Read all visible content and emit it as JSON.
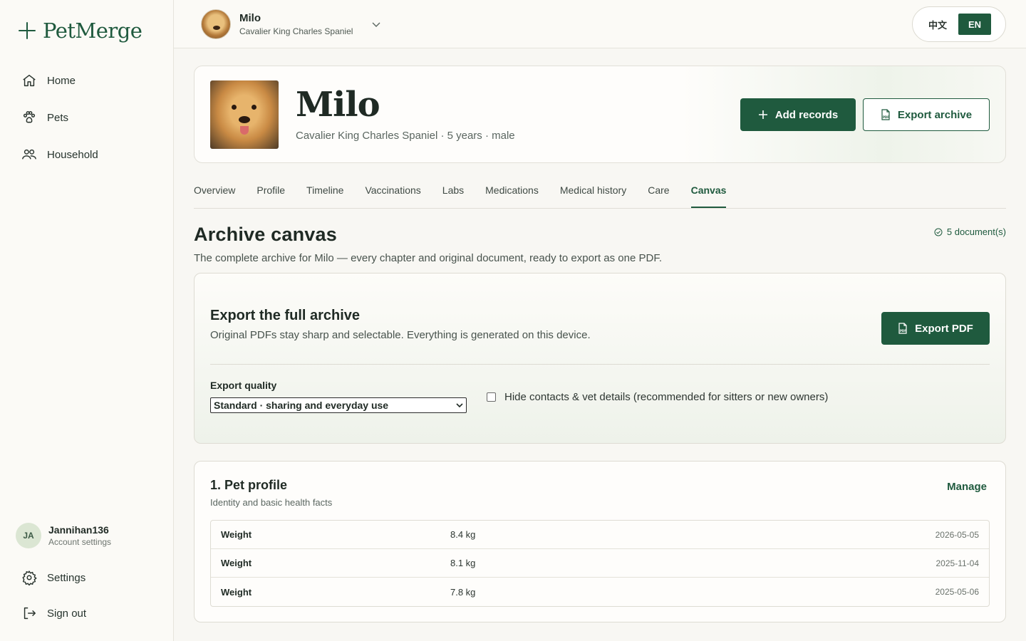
{
  "brand": {
    "name": "PetMerge"
  },
  "sidebar": {
    "items": [
      {
        "label": "Home",
        "icon": "home-icon"
      },
      {
        "label": "Pets",
        "icon": "paw-icon"
      },
      {
        "label": "Household",
        "icon": "people-icon"
      }
    ],
    "user": {
      "initials": "JA",
      "name": "Jannihan136",
      "sub": "Account settings"
    },
    "settings_label": "Settings",
    "signout_label": "Sign out"
  },
  "topbar": {
    "pet_name": "Milo",
    "pet_breed": "Cavalier King Charles Spaniel",
    "lang_zh": "中文",
    "lang_en": "EN"
  },
  "hero": {
    "name": "Milo",
    "meta": "Cavalier King Charles Spaniel · 5 years · male",
    "add_records": "Add records",
    "export_archive": "Export archive"
  },
  "tabs": [
    "Overview",
    "Profile",
    "Timeline",
    "Vaccinations",
    "Labs",
    "Medications",
    "Medical history",
    "Care",
    "Canvas"
  ],
  "active_tab": "Canvas",
  "canvas": {
    "title": "Archive canvas",
    "doc_count": "5 document(s)",
    "subtitle": "The complete archive for Milo — every chapter and original document, ready to export as one PDF."
  },
  "export": {
    "title": "Export the full archive",
    "subtitle": "Original PDFs stay sharp and selectable. Everything is generated on this device.",
    "button": "Export PDF",
    "quality_label": "Export quality",
    "quality_value": "Standard · sharing and everyday use",
    "hide_label": "Hide contacts & vet details (recommended for sitters or new owners)",
    "hide_checked": false
  },
  "profile": {
    "title": "1. Pet profile",
    "subtitle": "Identity and basic health facts",
    "manage": "Manage",
    "rows": [
      {
        "key": "Weight",
        "value": "8.4 kg",
        "date": "2026-05-05"
      },
      {
        "key": "Weight",
        "value": "8.1 kg",
        "date": "2025-11-04"
      },
      {
        "key": "Weight",
        "value": "7.8 kg",
        "date": "2025-05-06"
      }
    ]
  },
  "colors": {
    "brand": "#1f5a3e",
    "background": "#f8f7f3"
  }
}
